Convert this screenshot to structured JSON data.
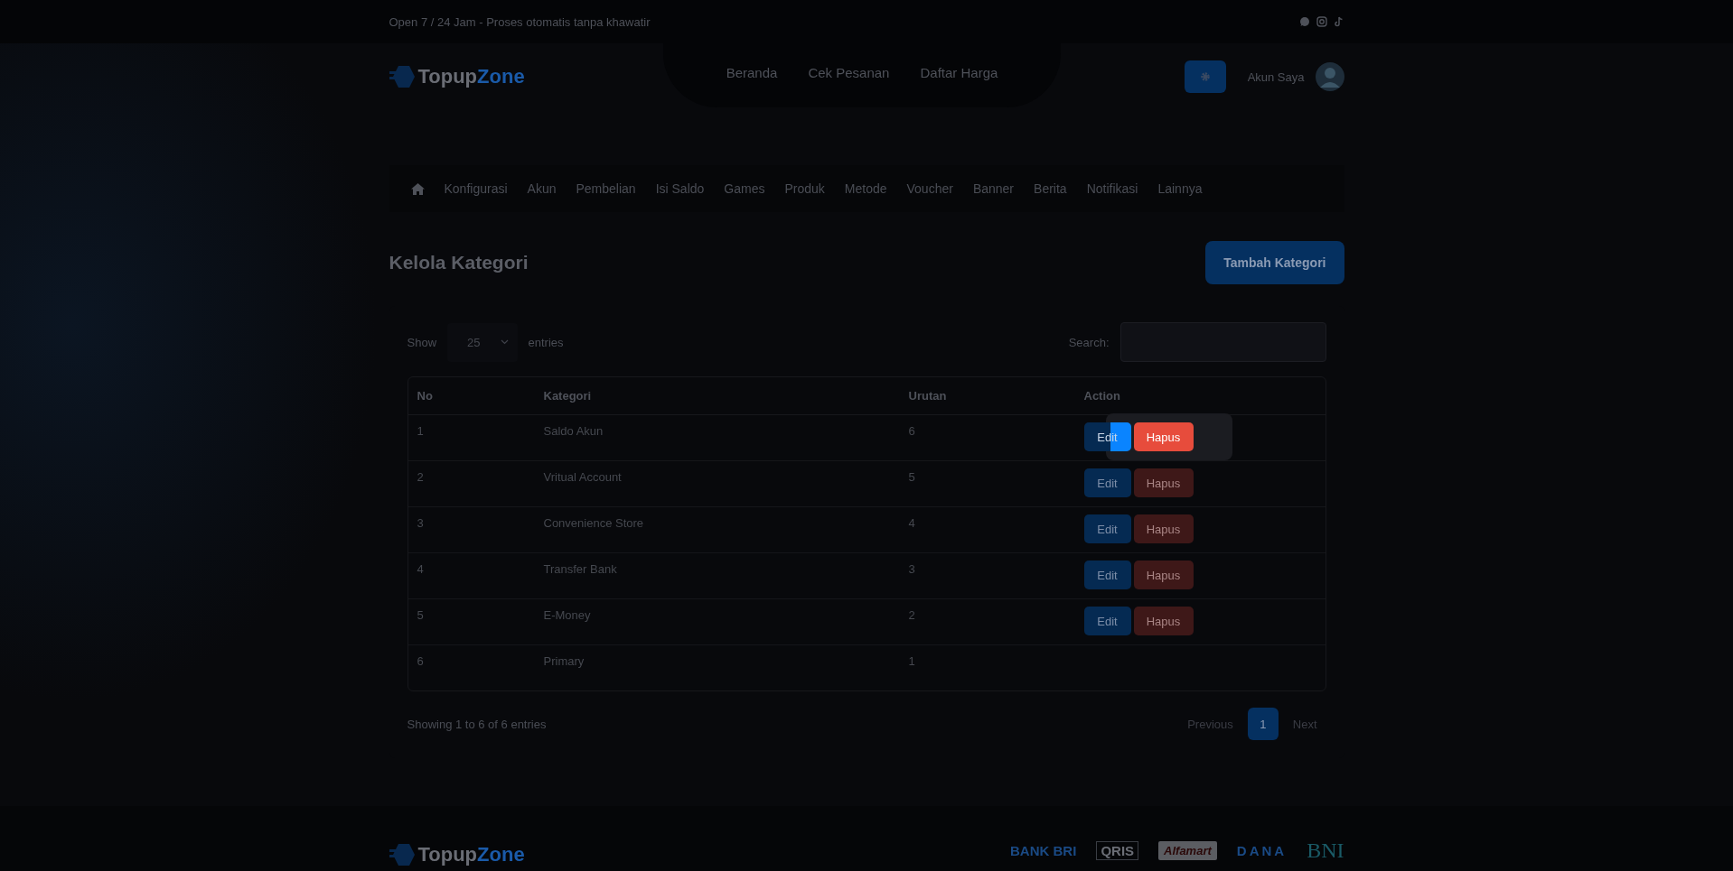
{
  "top_bar": {
    "text": "Open 7 / 24 Jam - Proses otomatis tanpa khawatir"
  },
  "header": {
    "brand": {
      "part_1": "Topup",
      "part_2": "Zone"
    },
    "nav": [
      "Beranda",
      "Cek Pesanan",
      "Daftar Harga"
    ],
    "account_label": "Akun Saya"
  },
  "admin_menu": [
    "Konfigurasi",
    "Akun",
    "Pembelian",
    "Isi Saldo",
    "Games",
    "Produk",
    "Metode",
    "Voucher",
    "Banner",
    "Berita",
    "Notifikasi",
    "Lainnya"
  ],
  "page_title": "Kelola Kategori",
  "add_button": "Tambah Kategori",
  "table_controls": {
    "show_label": "Show",
    "page_size": "25",
    "entries_label": "entries",
    "search_label": "Search:"
  },
  "table": {
    "columns": [
      "No",
      "Kategori",
      "Urutan",
      "Action"
    ],
    "rows": [
      {
        "no": "1",
        "kategori": "Saldo Akun",
        "urutan": "6",
        "edit": {
          "label": "Edit"
        },
        "delete": {
          "label": "Hapus",
          "highlighted": true
        }
      },
      {
        "no": "2",
        "kategori": "Vritual Account",
        "urutan": "5",
        "edit": {
          "label": "Edit"
        },
        "delete": {
          "label": "Hapus",
          "highlighted": false
        }
      },
      {
        "no": "3",
        "kategori": "Convenience Store",
        "urutan": "4",
        "edit": {
          "label": "Edit"
        },
        "delete": {
          "label": "Hapus",
          "highlighted": false
        }
      },
      {
        "no": "4",
        "kategori": "Transfer Bank",
        "urutan": "3",
        "edit": {
          "label": "Edit"
        },
        "delete": {
          "label": "Hapus",
          "highlighted": false
        }
      },
      {
        "no": "5",
        "kategori": "E-Money",
        "urutan": "2",
        "edit": {
          "label": "Edit"
        },
        "delete": {
          "label": "Hapus",
          "highlighted": false
        }
      },
      {
        "no": "6",
        "kategori": "Primary",
        "urutan": "1"
      }
    ]
  },
  "info": "Showing 1 to 6 of 6 entries",
  "pagination": [
    {
      "label": "Previous",
      "selected": false
    },
    {
      "label": "1",
      "selected": true
    },
    {
      "label": "Next",
      "selected": false
    }
  ],
  "footer": {
    "brand": {
      "part_1": "Topup",
      "part_2": "Zone"
    },
    "payment_logos": [
      "BANK BRI",
      "QRIS",
      "Alfamart",
      "DANA",
      "BNI"
    ]
  }
}
